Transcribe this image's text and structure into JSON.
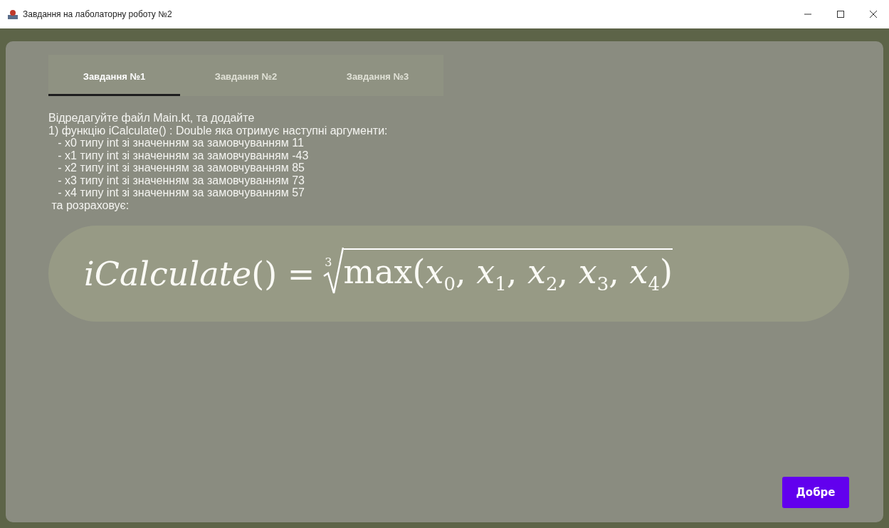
{
  "window": {
    "title": "Завдання на лаболаторну роботу №2"
  },
  "tabs": [
    {
      "label": "Завдання №1",
      "selected": true
    },
    {
      "label": "Завдання №2",
      "selected": false
    },
    {
      "label": "Завдання №3",
      "selected": false
    }
  ],
  "task_lines": [
    "Відредагуйте файл Main.kt, та додайте",
    "1) функцію iCalculate() : Double яка отримує наступні аргументи:",
    "   - x0 типу int зі значенням за замовчуванням 11",
    "   - x1 типу int зі значенням за замовчуванням -43",
    "   - x2 типу int зі значенням за замовчуванням 85",
    "   - x3 типу int зі значенням за замовчуванням 73",
    "   - x4 типу int зі значенням за замовчуванням 57",
    " та розраховує:"
  ],
  "formula": {
    "lhs": "*iCalculate*() =",
    "root_index": "3",
    "radicand": "max(*x*$_{0}$, *x*$_{1}$, *x*$_{2}$, *x*$_{3}$, *x*$_{4}$)"
  },
  "ok_button": "Добре"
}
